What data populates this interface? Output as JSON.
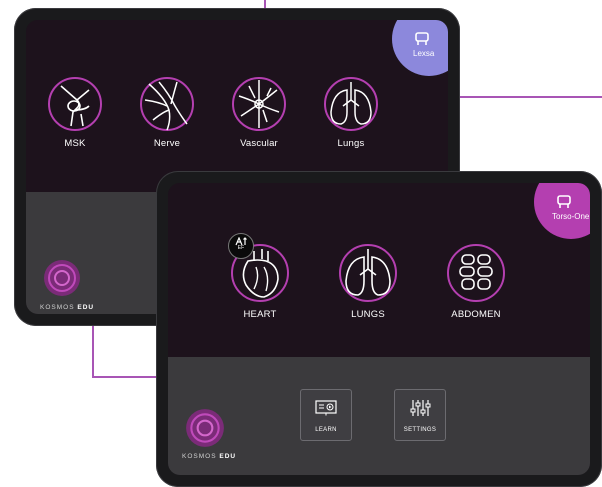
{
  "back_tablet": {
    "badge_label": "Lexsa",
    "presets": [
      {
        "label": "MSK",
        "icon": "knee-joint-icon"
      },
      {
        "label": "Nerve",
        "icon": "nerve-icon"
      },
      {
        "label": "Vascular",
        "icon": "vascular-icon"
      },
      {
        "label": "Lungs",
        "icon": "lungs-icon"
      }
    ],
    "brand_prefix": "KOSMOS",
    "brand_suffix": "EDU"
  },
  "front_tablet": {
    "badge_label": "Torso-One",
    "presets": [
      {
        "label": "HEART",
        "icon": "heart-icon"
      },
      {
        "label": "LUNGS",
        "icon": "lungs-icon"
      },
      {
        "label": "ABDOMEN",
        "icon": "abdomen-icon"
      }
    ],
    "ef_badge": "EF",
    "buttons": [
      {
        "label": "LEARN",
        "icon": "learn-icon"
      },
      {
        "label": "SETTINGS",
        "icon": "settings-sliders-icon"
      }
    ],
    "brand_prefix": "KOSMOS",
    "brand_suffix": "EDU"
  },
  "colors": {
    "accent": "#b43fb0",
    "probe_badge_back": "#8c88dc",
    "screen_bg": "#1d121c",
    "bottom_bar": "#3b3a3d"
  }
}
